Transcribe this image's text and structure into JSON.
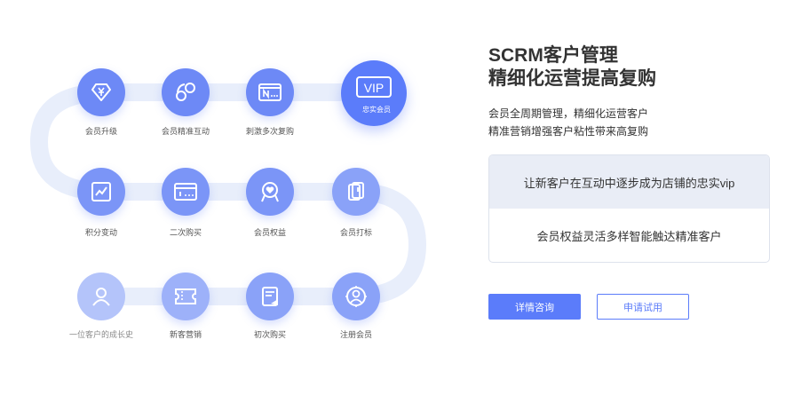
{
  "flow": {
    "row1": [
      "会员升级",
      "会员精准互动",
      "刺激多次复购"
    ],
    "vip": {
      "badge": "VIP",
      "label": "忠实会员"
    },
    "row2": [
      "积分变动",
      "二次购买",
      "会员权益",
      "会员打标"
    ],
    "row3": [
      "一位客户的成长史",
      "新客营销",
      "初次购买",
      "注册会员"
    ],
    "icons": [
      "diamond-yen-icon",
      "interaction-icon",
      "window-n-icon",
      "vip-badge-icon",
      "trend-chart-icon",
      "card-icon",
      "heart-badge-icon",
      "tag-icon",
      "user-icon",
      "ticket-icon",
      "receipt-icon",
      "target-user-icon"
    ]
  },
  "content": {
    "title_line1": "SCRM客户管理",
    "title_line2": "精细化运营提高复购",
    "desc_line1": "会员全周期管理，精细化运营客户",
    "desc_line2": "精准营销增强客户粘性带来高复购",
    "card_items": [
      "让新客户在互动中逐步成为店铺的忠实vip",
      "会员权益灵活多样智能触达精准客户"
    ]
  },
  "buttons": {
    "primary": "详情咨询",
    "secondary": "申请试用"
  },
  "colors": {
    "accent": "#5b7cfa",
    "path": "#e8eefb",
    "node_dark": "#6d89f6",
    "node_mid": "#8aa2f8",
    "node_light": "#b4c4fa"
  }
}
